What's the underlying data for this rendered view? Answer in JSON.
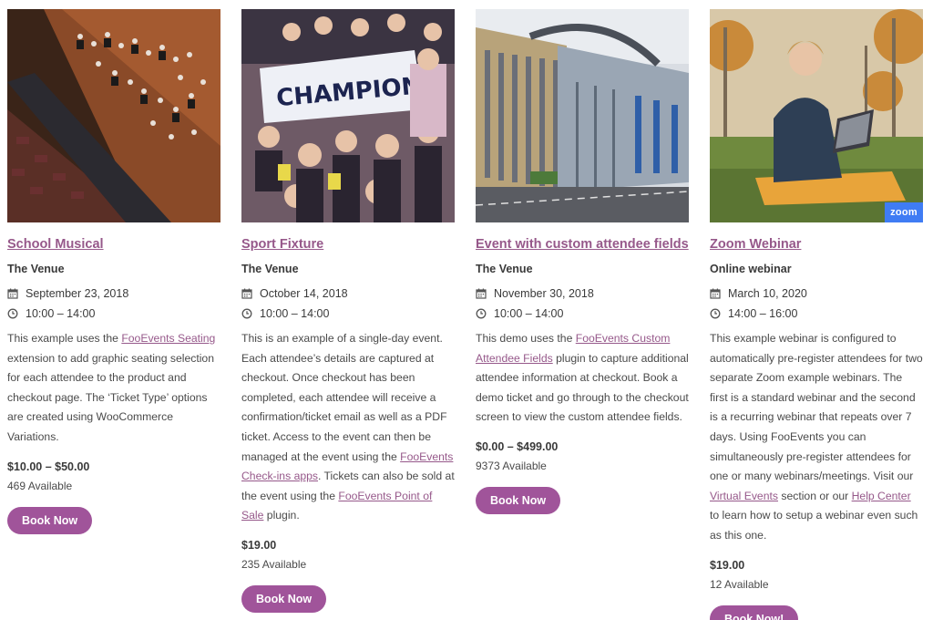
{
  "events": [
    {
      "title": "School Musical",
      "venue": "The Venue",
      "date": "September 23, 2018",
      "time": "10:00 – 14:00",
      "desc": {
        "p1": "This example uses the ",
        "l1": "FooEvents Seating",
        "p2": " extension to add graphic seating selection for each attendee to the product and checkout page. The ‘Ticket Type’ options are created using WooCommerce Variations."
      },
      "price": "$10.00 – $50.00",
      "available": "469 Available",
      "button": "Book Now"
    },
    {
      "title": "Sport Fixture",
      "venue": "The Venue",
      "date": "October 14, 2018",
      "time": "10:00 – 14:00",
      "desc": {
        "p1": "This is an example of a single-day event. Each attendee’s details are captured at checkout. Once checkout has been completed, each attendee will receive a confirmation/ticket email as well as a PDF ticket. Access to the event can then be managed at the event using the ",
        "l1": "FooEvents Check-ins apps",
        "p2": ". Tickets can also be sold at the event using the ",
        "l2": "FooEvents Point of Sale",
        "p3": " plugin."
      },
      "price": "$19.00",
      "available": "235 Available",
      "button": "Book Now"
    },
    {
      "title": "Event with custom attendee fields",
      "venue": "The Venue",
      "date": "November 30, 2018",
      "time": "10:00 – 14:00",
      "desc": {
        "p1": "This demo uses the ",
        "l1": "FooEvents Custom Attendee Fields",
        "p2": " plugin to capture additional attendee information at checkout. Book a demo ticket and go through to the checkout screen to view the custom attendee fields."
      },
      "price": "$0.00 – $499.00",
      "available": "9373 Available",
      "button": "Book Now"
    },
    {
      "title": "Zoom Webinar",
      "venue": "Online webinar",
      "date": "March 10, 2020",
      "time": "14:00 – 16:00",
      "badge": "zoom",
      "desc": {
        "p1": "This example webinar is configured to automatically pre-register attendees for two separate Zoom example webinars. The first is a standard webinar and the second is a recurring webinar that repeats over 7 days. Using FooEvents you can simultaneously pre-register attendees for one or many webinars/meetings. Visit our ",
        "l1": "Virtual Events",
        "p2": " section or our ",
        "l2": "Help Center",
        "p3": " to learn how to setup a webinar even such as this one."
      },
      "price": "$19.00",
      "available": "12 Available",
      "button": "Book Now!"
    }
  ],
  "colors": {
    "accent": "#96588a",
    "button": "#a0549a",
    "zoom": "#3f7cf4"
  }
}
